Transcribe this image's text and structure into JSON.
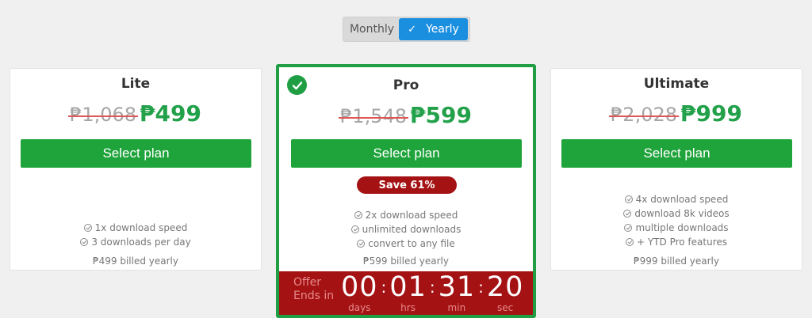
{
  "toggle": {
    "monthly_label": "Monthly",
    "yearly_label": "Yearly",
    "selected": "Yearly"
  },
  "plans": [
    {
      "name": "Lite",
      "old_price": "₱1,068",
      "new_price": "₱499",
      "button_label": "Select plan",
      "features": [
        "1x download speed",
        "3 downloads per day"
      ],
      "billed": "₱499 billed yearly"
    },
    {
      "name": "Pro",
      "old_price": "₱1,548",
      "new_price": "₱599",
      "button_label": "Select plan",
      "badge": "Save 61%",
      "features": [
        "2x download speed",
        "unlimited downloads",
        "convert to any file"
      ],
      "billed": "₱599 billed yearly",
      "selected": true
    },
    {
      "name": "Ultimate",
      "old_price": "₱2,028",
      "new_price": "₱999",
      "button_label": "Select plan",
      "features": [
        "4x download speed",
        "download 8k videos",
        "multiple downloads",
        "+ YTD Pro features"
      ],
      "billed": "₱999 billed yearly"
    }
  ],
  "countdown": {
    "offer_label": "Offer Ends in",
    "days": "00",
    "days_label": "days",
    "hrs": "01",
    "hrs_label": "hrs",
    "min": "31",
    "min_label": "min",
    "sec": "20",
    "sec_label": "sec"
  },
  "colors": {
    "accent_green": "#1fa33b",
    "price_green": "#23a14a",
    "toggle_blue": "#1a8fe0",
    "offer_red": "#a41214"
  }
}
